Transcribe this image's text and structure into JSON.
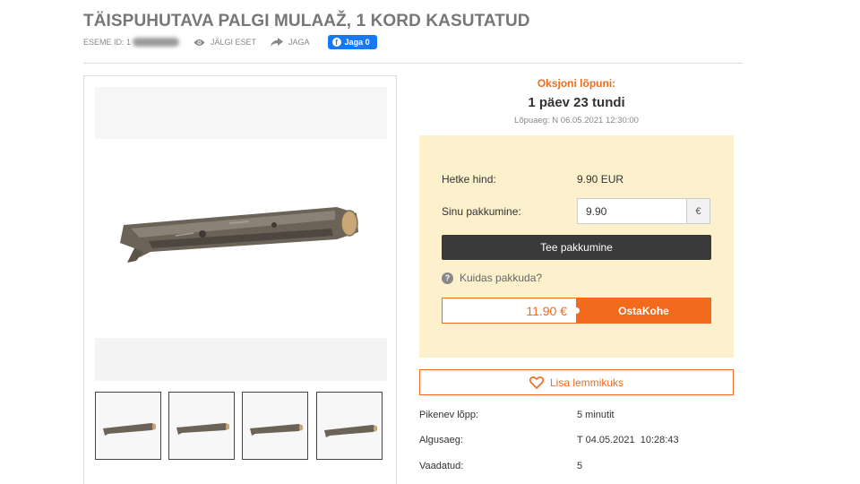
{
  "item": {
    "title": "TÄISPUHUTAVA PALGI MULAAŽ, 1 KORD KASUTATUD",
    "id_label": "ESEME ID: 1"
  },
  "actions": {
    "watch_label": "JÄLGI ESET",
    "share_label": "JAGA",
    "fb_share_label": "Jaga 0"
  },
  "auction": {
    "ends_label": "Oksjoni lõpuni:",
    "time_remaining": "1 päev 23 tundi",
    "end_time": "Lõpuaeg: N 06.05.2021 12:30:00"
  },
  "bidding": {
    "current_price_label": "Hetke hind:",
    "current_price": "9.90 EUR",
    "your_bid_label": "Sinu pakkumine:",
    "your_bid_value": "9.90",
    "currency_symbol": "€",
    "place_bid_label": "Tee pakkumine",
    "how_to_bid_label": "Kuidas pakkuda?",
    "buy_now_price": "11.90 €",
    "buy_now_label": "OstaKohe"
  },
  "favorite": {
    "label": "Lisa lemmikuks"
  },
  "details": [
    {
      "label": "Pikenev lõpp:",
      "value": "5 minutit"
    },
    {
      "label": "Algusaeg:",
      "value": "T 04.05.2021  10:28:43"
    },
    {
      "label": "Vaadatud:",
      "value": "5"
    }
  ],
  "colors": {
    "accent": "#f26b1d",
    "bid_panel_bg": "#fdf0cc",
    "dark_button": "#3a3a3a",
    "facebook": "#1877f2"
  }
}
